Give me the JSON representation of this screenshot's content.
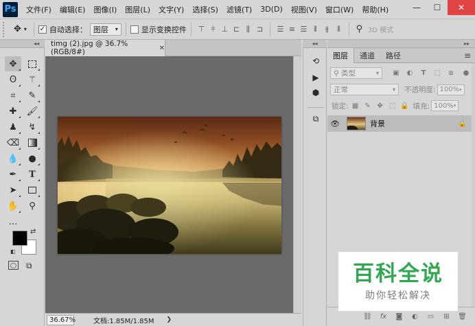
{
  "app": {
    "logo": "Ps"
  },
  "menu": [
    "文件(F)",
    "编辑(E)",
    "图像(I)",
    "图层(L)",
    "文字(Y)",
    "选择(S)",
    "滤镜(T)",
    "3D(D)",
    "视图(V)",
    "窗口(W)",
    "帮助(H)"
  ],
  "window_controls": {
    "minimize": "—",
    "maximize": "☐",
    "close": "✕"
  },
  "options": {
    "auto_select_label": "自动选择：",
    "auto_select_checked": true,
    "auto_select_value": "图层",
    "show_transform_label": "显示变换控件",
    "show_transform_checked": false,
    "mode_3d": "3D 模式"
  },
  "document": {
    "tab_title": "timg (2).jpg @ 36.7%(RGB/8#)",
    "tab_close": "✕",
    "zoom": "36.67%",
    "info": "文档:1.85M/1.85M"
  },
  "layers_panel": {
    "tabs": [
      "图层",
      "通道",
      "路径"
    ],
    "filter_kind": "类型",
    "blend_mode": "正常",
    "opacity_label": "不透明度:",
    "opacity_value": "100%",
    "lock_label": "锁定:",
    "fill_label": "填充:",
    "fill_value": "100%",
    "layers": [
      {
        "name": "背景",
        "visible": true,
        "locked": true
      }
    ]
  },
  "watermark": {
    "main": "百科全说",
    "sub": "助你轻松解决"
  },
  "colors": {
    "foreground": "#000000",
    "background": "#ffffff",
    "canvas_bg": "#6a6a6a",
    "watermark_green": "#2fa84f"
  },
  "icons": {
    "tools": [
      "move-icon",
      "marquee-icon",
      "lasso-icon",
      "magic-wand-icon",
      "crop-icon",
      "eyedropper-icon",
      "healing-brush-icon",
      "brush-icon",
      "clone-stamp-icon",
      "history-brush-icon",
      "eraser-icon",
      "gradient-icon",
      "blur-icon",
      "dodge-icon",
      "pen-icon",
      "type-icon",
      "path-select-icon",
      "rectangle-icon",
      "hand-icon",
      "zoom-icon",
      "more-tools-icon"
    ]
  }
}
